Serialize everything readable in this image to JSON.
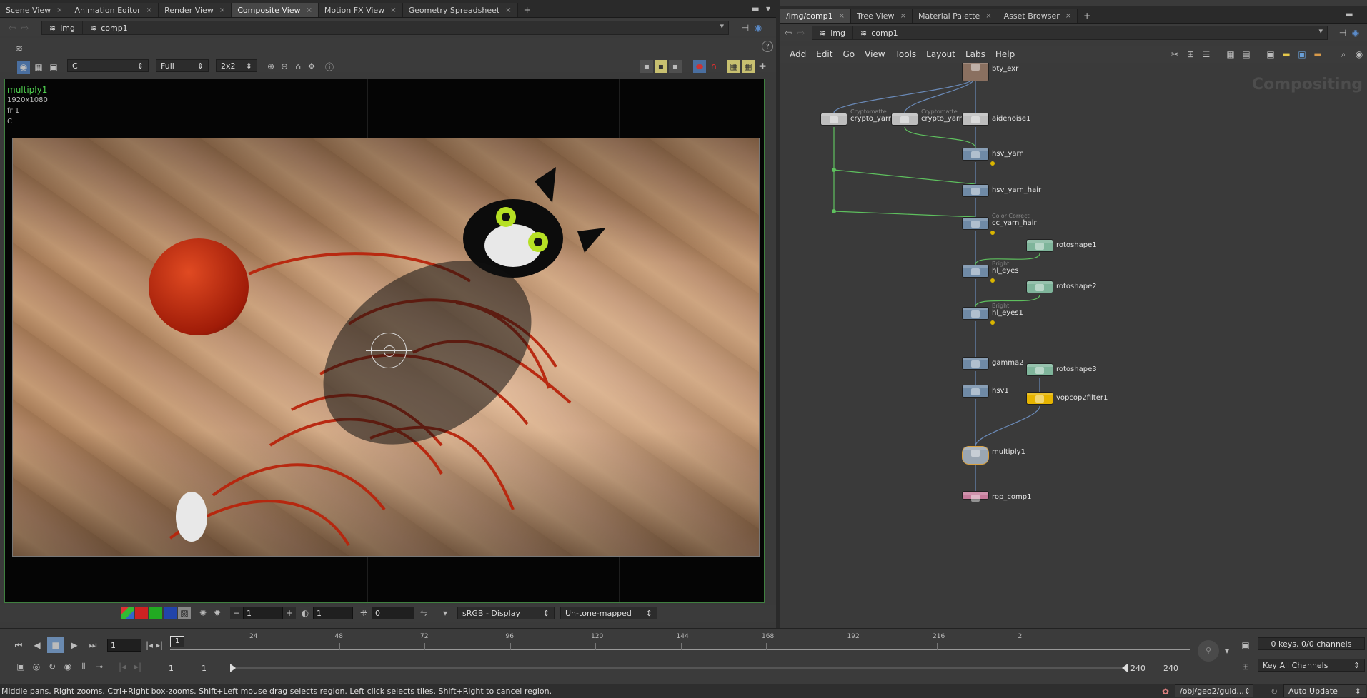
{
  "left_tabs": [
    {
      "label": "Scene View",
      "active": false
    },
    {
      "label": "Animation Editor",
      "active": false
    },
    {
      "label": "Render View",
      "active": false
    },
    {
      "label": "Composite View",
      "active": true
    },
    {
      "label": "Motion FX View",
      "active": false
    },
    {
      "label": "Geometry Spreadsheet",
      "active": false
    }
  ],
  "right_tabs": [
    {
      "label": "/img/comp1",
      "active": true
    },
    {
      "label": "Tree View",
      "active": false
    },
    {
      "label": "Material Palette",
      "active": false
    },
    {
      "label": "Asset Browser",
      "active": false
    }
  ],
  "left_path": {
    "crumb1": "img",
    "crumb2": "comp1"
  },
  "right_path": {
    "crumb1": "img",
    "crumb2": "comp1"
  },
  "viewer_toolbar": {
    "plane": "C",
    "resolution": "Full",
    "tiles": "2x2"
  },
  "viewer_info": {
    "node": "multiply1",
    "size": "1920x1080",
    "frame": "fr 1",
    "plane": "C"
  },
  "viewer_bottom": {
    "exposure": "1",
    "gamma": "1",
    "offset": "0",
    "display": "sRGB - Display",
    "tonemap": "Un-tone-mapped"
  },
  "network_menu": [
    "Add",
    "Edit",
    "Go",
    "View",
    "Tools",
    "Layout",
    "Labs",
    "Help"
  ],
  "network_watermark": "Compositing",
  "nodes": [
    {
      "id": "bty_exr",
      "label": "bty_exr",
      "sub": "",
      "kind": "image"
    },
    {
      "id": "crypto_yarn_hair",
      "label": "crypto_yarn_hair",
      "sub": "Cryptomatte",
      "kind": "gray"
    },
    {
      "id": "crypto_yarn",
      "label": "crypto_yarn",
      "sub": "Cryptomatte",
      "kind": "gray"
    },
    {
      "id": "aidenoise1",
      "label": "aidenoise1",
      "sub": "",
      "kind": "gray"
    },
    {
      "id": "hsv_yarn",
      "label": "hsv_yarn",
      "sub": "",
      "kind": "blue"
    },
    {
      "id": "hsv_yarn_hair",
      "label": "hsv_yarn_hair",
      "sub": "",
      "kind": "blue"
    },
    {
      "id": "cc_yarn_hair",
      "label": "cc_yarn_hair",
      "sub": "Color Correct",
      "kind": "blue"
    },
    {
      "id": "rotoshape1",
      "label": "rotoshape1",
      "sub": "",
      "kind": "green"
    },
    {
      "id": "hl_eyes",
      "label": "hl_eyes",
      "sub": "Bright",
      "kind": "blue"
    },
    {
      "id": "rotoshape2",
      "label": "rotoshape2",
      "sub": "",
      "kind": "green"
    },
    {
      "id": "hl_eyes1",
      "label": "hl_eyes1",
      "sub": "Bright",
      "kind": "blue"
    },
    {
      "id": "gamma2",
      "label": "gamma2",
      "sub": "",
      "kind": "blue"
    },
    {
      "id": "rotoshape3",
      "label": "rotoshape3",
      "sub": "",
      "kind": "green"
    },
    {
      "id": "hsv1",
      "label": "hsv1",
      "sub": "",
      "kind": "blue"
    },
    {
      "id": "vopcop2filter1",
      "label": "vopcop2filter1",
      "sub": "",
      "kind": "yellow"
    },
    {
      "id": "multiply1",
      "label": "multiply1",
      "sub": "",
      "kind": "display"
    },
    {
      "id": "rop_comp1",
      "label": "rop_comp1",
      "sub": "",
      "kind": "pink"
    }
  ],
  "timeline": {
    "current_frame": "1",
    "marker": "1",
    "ticks": [
      "24",
      "48",
      "72",
      "96",
      "120",
      "144",
      "168",
      "192",
      "216",
      "2"
    ],
    "range_start": "1",
    "range_start2": "1",
    "range_end": "240",
    "range_end2": "240",
    "keys_info": "0 keys, 0/0 channels",
    "key_mode": "Key All Channels"
  },
  "status": {
    "message": "Middle pans. Right zooms. Ctrl+Right box-zooms. Shift+Left mouse drag selects region. Left click selects tiles. Shift+Right to cancel region.",
    "path": "/obj/geo2/guid...",
    "update_mode": "Auto Update"
  },
  "colors": {
    "accent": "#4fb84f",
    "node_blue": "#6f8aa6",
    "node_green": "#7fb59b",
    "node_yellow": "#e6b400",
    "node_gray": "#bdbdbd",
    "node_pink": "#c57a9a"
  }
}
